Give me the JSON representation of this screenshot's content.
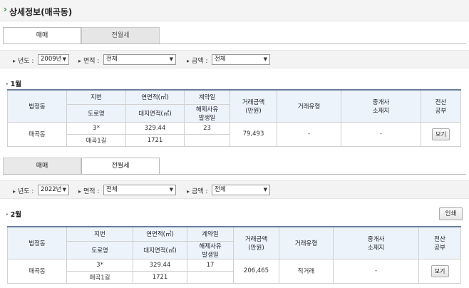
{
  "header": {
    "title": "상세정보(매곡동)"
  },
  "tabs": {
    "sale": "매매",
    "rent": "전월세"
  },
  "filter": {
    "year_label": "년도 :",
    "area_label": "면적 :",
    "amount_label": "금액 :",
    "area_value": "전체",
    "amount_value": "전체"
  },
  "section1": {
    "year_value": "2009년",
    "month": "1월",
    "row": {
      "dong": "매곡동",
      "jibun": "3*",
      "road": "매곡1길",
      "area": "329.44",
      "land_area": "1721",
      "contract_day": "23",
      "cancel_day": "",
      "amount": "79,493",
      "deal_type": "-",
      "agent": "-",
      "view": "보기"
    }
  },
  "section2": {
    "year_value": "2022년",
    "month": "2월",
    "print": "인쇄",
    "row": {
      "dong": "매곡동",
      "jibun": "3*",
      "road": "매곡1길",
      "area": "329.44",
      "land_area": "1721",
      "contract_day": "17",
      "cancel_day": "",
      "amount": "206,465",
      "deal_type": "직거래",
      "agent": "-",
      "view": "보기"
    }
  },
  "columns": {
    "dong": "법정동",
    "jibun": "지번",
    "road": "도로명",
    "area": "연면적(㎡)",
    "land_area": "대지면적(㎡)",
    "contract": "계약일",
    "cancel_1": "해제사유",
    "cancel_2": "발생일",
    "amount_1": "거래금액",
    "amount_2": "(만원)",
    "deal_type": "거래유형",
    "agent_1": "중개사",
    "agent_2": "소재지",
    "ledger_1": "전산",
    "ledger_2": "공부"
  }
}
